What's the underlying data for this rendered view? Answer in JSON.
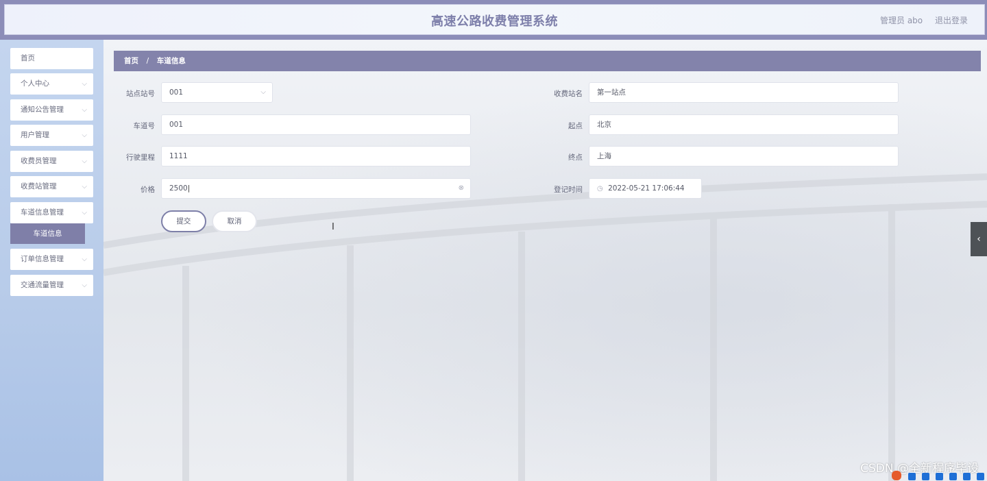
{
  "header": {
    "title": "高速公路收费管理系统",
    "user_label": "管理员 abo",
    "logout_label": "退出登录"
  },
  "sidebar": {
    "items": [
      {
        "label": "首页",
        "has_chevron": false
      },
      {
        "label": "个人中心",
        "has_chevron": true
      },
      {
        "label": "通知公告管理",
        "has_chevron": true
      },
      {
        "label": "用户管理",
        "has_chevron": true
      },
      {
        "label": "收费员管理",
        "has_chevron": true
      },
      {
        "label": "收费站管理",
        "has_chevron": true
      },
      {
        "label": "车道信息管理",
        "has_chevron": true
      },
      {
        "label": "订单信息管理",
        "has_chevron": true
      },
      {
        "label": "交通流量管理",
        "has_chevron": true
      }
    ],
    "active_sub": {
      "label": "车道信息"
    }
  },
  "breadcrumb": {
    "home": "首页",
    "separator": "/",
    "current": "车道信息"
  },
  "form": {
    "station_no": {
      "label": "站点站号",
      "value": "001"
    },
    "station_name": {
      "label": "收费站名",
      "value": "第一站点"
    },
    "lane_no": {
      "label": "车道号",
      "value": "001"
    },
    "start": {
      "label": "起点",
      "value": "北京"
    },
    "mileage": {
      "label": "行驶里程",
      "value": "1111"
    },
    "end": {
      "label": "终点",
      "value": "上海"
    },
    "price": {
      "label": "价格",
      "value": "2500"
    },
    "reg_time": {
      "label": "登记时间",
      "value": "2022-05-21 17:06:44"
    },
    "submit_label": "提交",
    "cancel_label": "取消"
  },
  "watermark": "CSDN @全新程序毕设",
  "colors": {
    "accent": "#8383ab",
    "sidebar": "#b7cbe9",
    "sub_active": "#7f7fa8"
  },
  "icons": [
    "chevron-down-icon",
    "clear-icon",
    "clock-icon",
    "collapse-left-icon"
  ]
}
